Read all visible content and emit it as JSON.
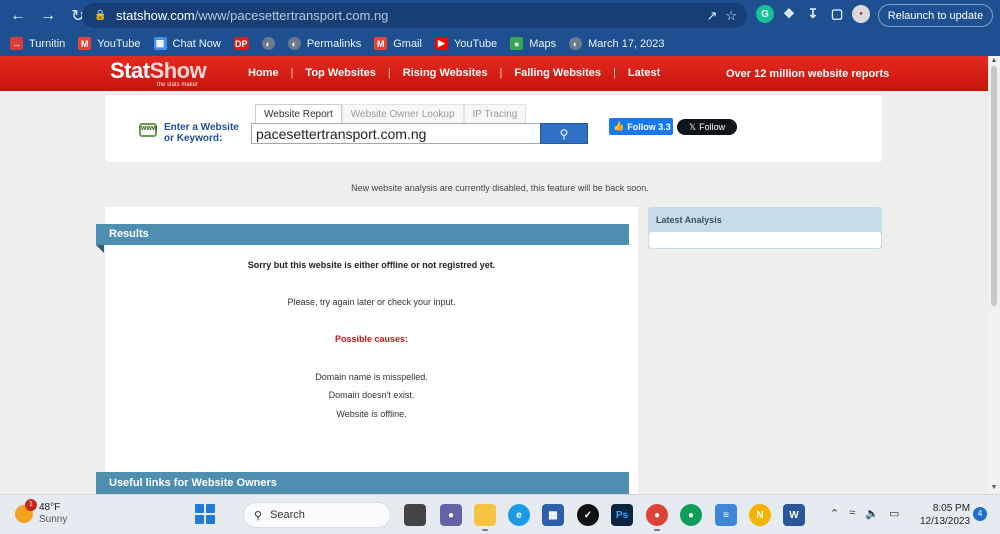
{
  "browser": {
    "url_host": "statshow.com",
    "url_path": "/www/pacesettertransport.com.ng",
    "relaunch_label": "Relaunch to update"
  },
  "bookmarks": [
    {
      "label": "Turnitin",
      "icon": "turnitin-icon",
      "color": "#d83b3b"
    },
    {
      "label": "YouTube",
      "icon": "gmail-icon",
      "color": "#ea4335"
    },
    {
      "label": "Chat Now",
      "icon": "grid-icon",
      "color": "#4a8fe7"
    },
    {
      "label": "",
      "icon": "dp-icon",
      "color": "#d21f1f"
    },
    {
      "label": "",
      "icon": "globe-icon",
      "color": "#6c7a8c"
    },
    {
      "label": "Permalinks",
      "icon": "globe-icon",
      "color": "#6c7a8c"
    },
    {
      "label": "Gmail",
      "icon": "gmail-icon",
      "color": "#ea4335"
    },
    {
      "label": "YouTube",
      "icon": "youtube-icon",
      "color": "#ff0000"
    },
    {
      "label": "Maps",
      "icon": "maps-icon",
      "color": "#34a853"
    },
    {
      "label": "March 17, 2023",
      "icon": "globe-icon",
      "color": "#6c7a8c"
    }
  ],
  "site": {
    "logo_stat": "Stat",
    "logo_show": "Show",
    "tagline": "the stats maker",
    "nav": [
      "Home",
      "Top Websites",
      "Rising Websites",
      "Falling Websites",
      "Latest"
    ],
    "reports": "Over 12 million website reports"
  },
  "search": {
    "enter_label_1": "Enter a Website",
    "enter_label_2": "or Keyword:",
    "tabs": [
      "Website Report",
      "Website Owner Lookup",
      "IP Tracing"
    ],
    "value": "pacesettertransport.com.ng",
    "fb_follow": "Follow 3.3",
    "x_follow": "Follow"
  },
  "notice": "New website analysis are currently disabled, this feature will be back soon.",
  "results": {
    "title": "Results",
    "sorry": "Sorry but this website is either offline or not registred yet.",
    "try_again": "Please, try again later or check your input.",
    "causes_title": "Possible causes:",
    "causes": [
      "Domain name is misspelled.",
      "Domain doesn't exist.",
      "Website is offline."
    ],
    "useful": "Useful links for Website Owners"
  },
  "latest": {
    "title": "Latest Analysis"
  },
  "taskbar": {
    "weather_badge": "1",
    "temp": "48°F",
    "condition": "Sunny",
    "search": "Search",
    "time": "8:05 PM",
    "date": "12/13/2023",
    "notifications": "4"
  }
}
